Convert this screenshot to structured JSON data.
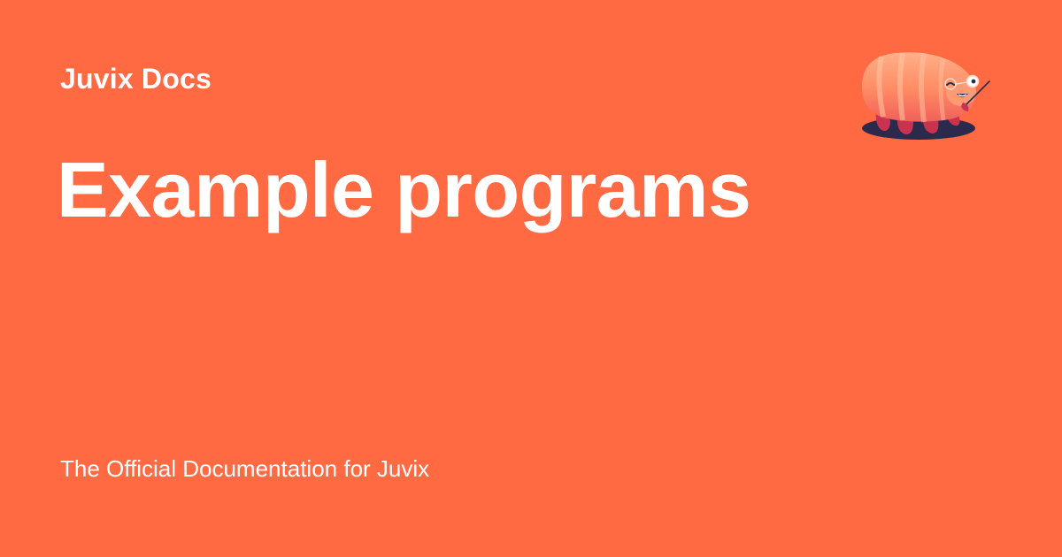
{
  "card": {
    "site_name": "Juvix Docs",
    "title": "Example programs",
    "description": "The Official Documentation for Juvix",
    "background_color": "#FF6A42",
    "text_color": "#FFFFFF"
  },
  "logo": {
    "icon": "juvix-tardigrade-mascot-icon"
  }
}
